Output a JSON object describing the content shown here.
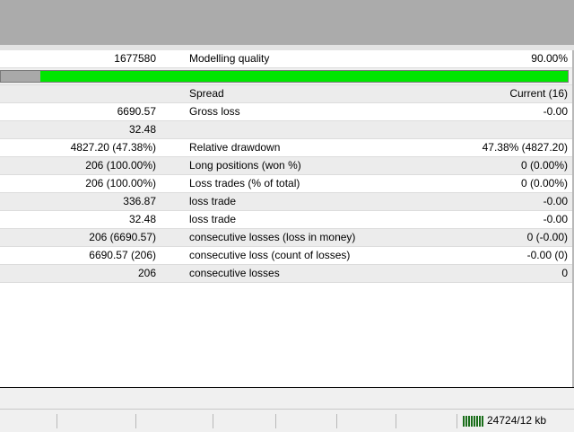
{
  "header": {
    "value": "1677580",
    "label": "Modelling quality",
    "value2": "90.00%"
  },
  "progress": {
    "fraction": 0.93
  },
  "rows": [
    {
      "v1": "",
      "label": "Spread",
      "v2": "Current (16)"
    },
    {
      "v1": "6690.57",
      "label": "Gross loss",
      "v2": "-0.00"
    },
    {
      "v1": "32.48",
      "label": "",
      "v2": ""
    },
    {
      "v1": "4827.20 (47.38%)",
      "label": "Relative drawdown",
      "v2": "47.38% (4827.20)"
    },
    {
      "v1": "206 (100.00%)",
      "label": "Long positions (won %)",
      "v2": "0 (0.00%)"
    },
    {
      "v1": "206 (100.00%)",
      "label": "Loss trades (% of total)",
      "v2": "0 (0.00%)"
    },
    {
      "v1": "336.87",
      "label": "loss trade",
      "v2": "-0.00"
    },
    {
      "v1": "32.48",
      "label": "loss trade",
      "v2": "-0.00"
    },
    {
      "v1": "206 (6690.57)",
      "label": "consecutive losses (loss in money)",
      "v2": "0 (-0.00)"
    },
    {
      "v1": "6690.57 (206)",
      "label": "consecutive loss (count of losses)",
      "v2": "-0.00 (0)"
    },
    {
      "v1": "206",
      "label": "consecutive losses",
      "v2": "0"
    }
  ],
  "status": {
    "traffic": "24724/12 kb",
    "icon": "connection-bars-icon"
  }
}
